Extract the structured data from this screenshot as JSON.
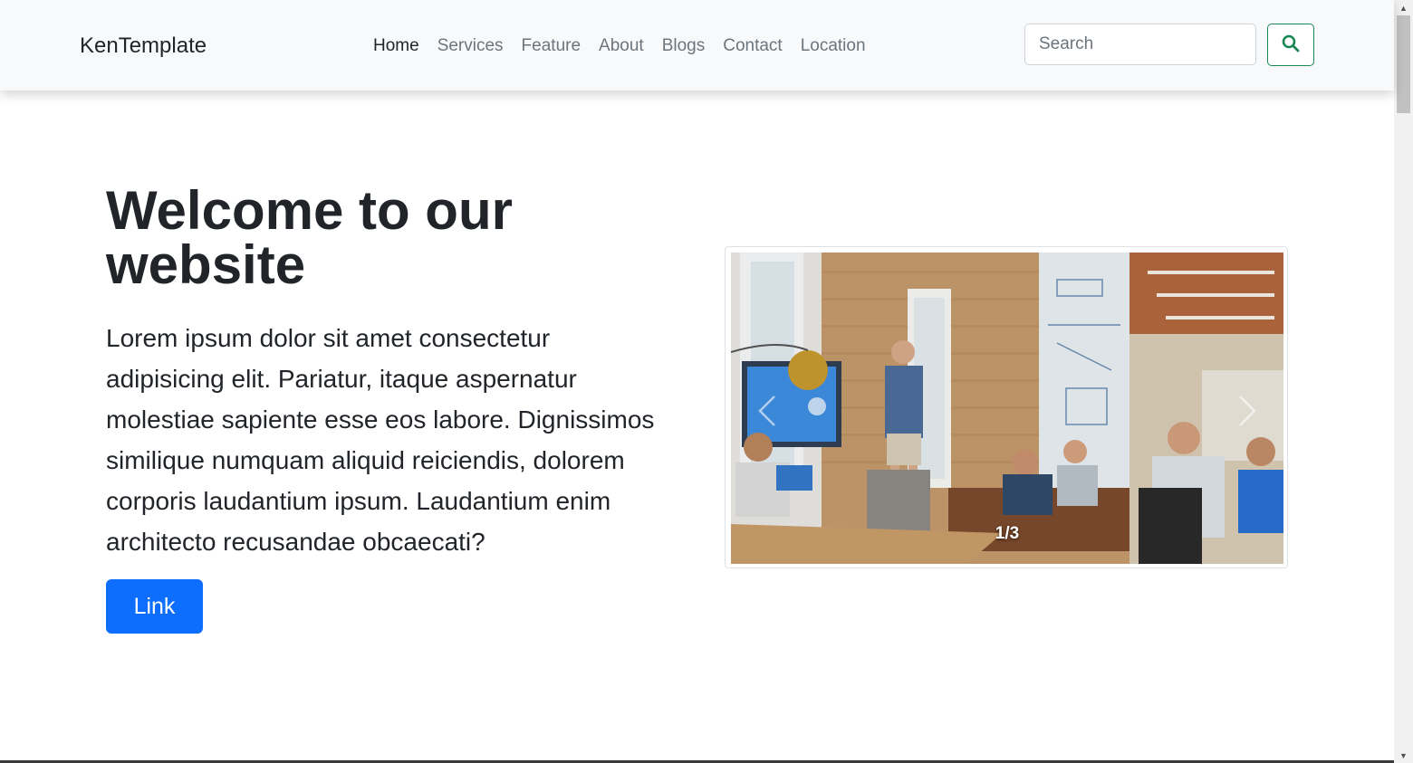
{
  "navbar": {
    "brand": "KenTemplate",
    "links": [
      {
        "label": "Home",
        "active": true
      },
      {
        "label": "Services",
        "active": false
      },
      {
        "label": "Feature",
        "active": false
      },
      {
        "label": "About",
        "active": false
      },
      {
        "label": "Blogs",
        "active": false
      },
      {
        "label": "Contact",
        "active": false
      },
      {
        "label": "Location",
        "active": false
      }
    ],
    "search": {
      "placeholder": "Search",
      "value": "",
      "button_icon": "search-icon"
    }
  },
  "hero": {
    "title": "Welcome to our website",
    "text": "Lorem ipsum dolor sit amet consectetur adipisicing elit. Pariatur, itaque aspernatur molestiae sapiente esse eos labore. Dignissimos similique numquam aliquid reiciendis, dolorem corporis laudantium ipsum. Laudantium enim architecto recusandae obcaecati?",
    "button_label": "Link"
  },
  "carousel": {
    "counter": "1/3",
    "prev_icon": "chevron-left-icon",
    "next_icon": "chevron-right-icon"
  },
  "colors": {
    "primary": "#0d6efd",
    "success": "#198754",
    "navbar_bg": "#f8f9fa",
    "muted": "#6c757d",
    "dark": "#212529"
  }
}
